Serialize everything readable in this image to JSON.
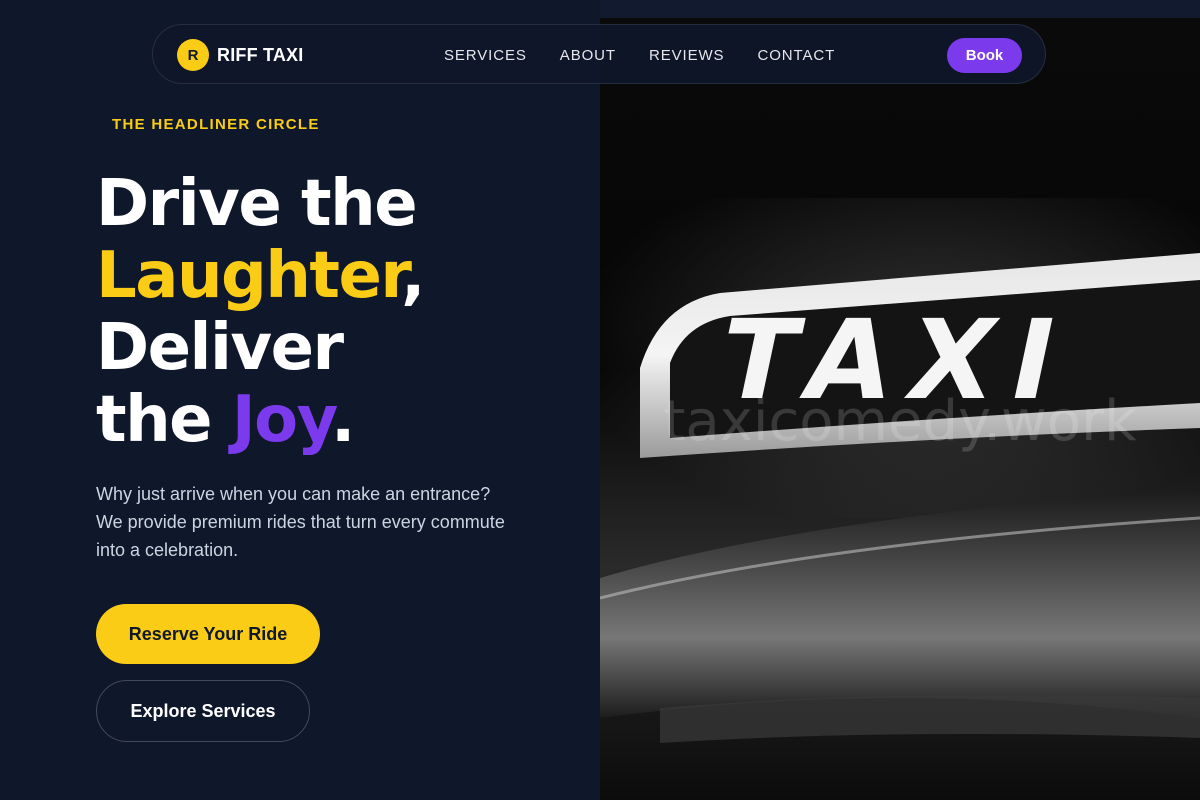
{
  "brand": {
    "initial": "R",
    "name": "RIFF TAXI"
  },
  "nav": {
    "links": [
      "SERVICES",
      "ABOUT",
      "REVIEWS",
      "CONTACT"
    ],
    "book_label": "Book"
  },
  "hero": {
    "eyebrow": "THE HEADLINER CIRCLE",
    "headline": {
      "line1": "Drive the",
      "highlight1": "Laughter",
      "comma": ",",
      "line3": "Deliver",
      "the": "the",
      "highlight2": "Joy",
      "period": "."
    },
    "subtext": "Why just arrive when you can make an entrance? We provide premium rides that turn every commute into a celebration.",
    "primary_cta": "Reserve Your Ride",
    "secondary_cta": "Explore Services"
  },
  "image": {
    "sign_text": "TAXI",
    "watermark": "taxicomedy.work"
  },
  "colors": {
    "background": "#0f172a",
    "accent_yellow": "#facc15",
    "accent_purple": "#7c3aed"
  }
}
